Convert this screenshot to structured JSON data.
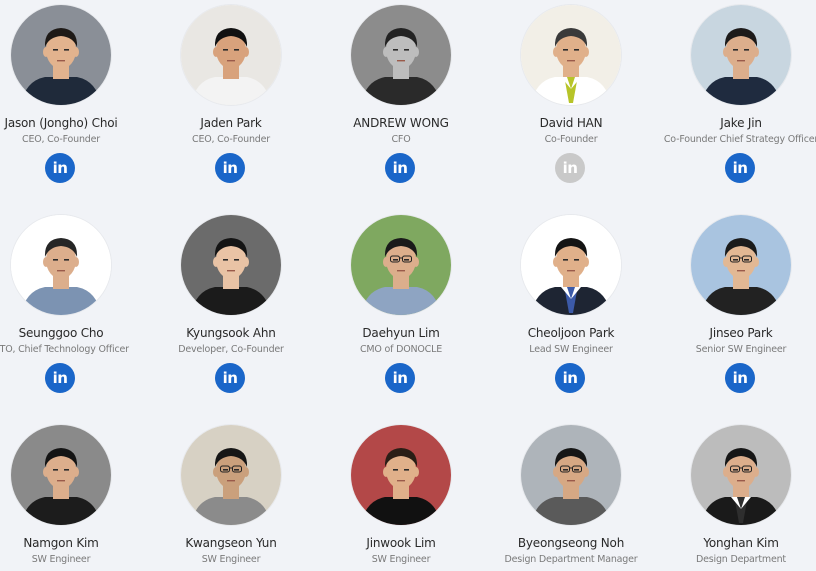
{
  "team": [
    {
      "name": "Jason (Jongho) Choi",
      "role": "CEO, Co-Founder",
      "linkedin": "in",
      "linkedin_active": true,
      "photo": {
        "bg": "#8a8f97",
        "skin": "#e2b38e",
        "hair": "#1e1a17",
        "shirt": "#1f2a3a",
        "glasses": false
      }
    },
    {
      "name": "Jaden Park",
      "role": "CEO, Co-Founder",
      "linkedin": "in",
      "linkedin_active": true,
      "photo": {
        "bg": "#e9e7e3",
        "skin": "#d8a27c",
        "hair": "#111111",
        "shirt": "#f3f3f3",
        "glasses": false
      }
    },
    {
      "name": "ANDREW WONG",
      "role": "CFO",
      "linkedin": "in",
      "linkedin_active": true,
      "photo": {
        "bg": "#8c8c8c",
        "skin": "#bdbdbd",
        "hair": "#222222",
        "shirt": "#2a2a2a",
        "glasses": false
      }
    },
    {
      "name": "David HAN",
      "role": "Co-Founder",
      "linkedin": "in",
      "linkedin_active": false,
      "photo": {
        "bg": "#f2efe7",
        "skin": "#e0b08a",
        "hair": "#3a3a3a",
        "shirt": "#ffffff",
        "glasses": false,
        "tie": "#b7c428"
      }
    },
    {
      "name": "Jake Jin",
      "role": "Co-Founder Chief Strategy Officer",
      "linkedin": "in",
      "linkedin_active": true,
      "photo": {
        "bg": "#c8d6e0",
        "skin": "#dcae8c",
        "hair": "#1d1b1a",
        "shirt": "#1f2b3f",
        "glasses": false
      }
    },
    {
      "name": "Seunggoo Cho",
      "role": "CTO, Chief Technology Officer",
      "linkedin": "in",
      "linkedin_active": true,
      "photo": {
        "bg": "#ffffff",
        "skin": "#dcae8c",
        "hair": "#262626",
        "shirt": "#7c93b2",
        "glasses": false
      }
    },
    {
      "name": "Kyungsook Ahn",
      "role": "Developer, Co-Founder",
      "linkedin": "in",
      "linkedin_active": true,
      "photo": {
        "bg": "#6b6b6b",
        "skin": "#e9c3a5",
        "hair": "#141414",
        "shirt": "#1b1b1b",
        "glasses": false
      }
    },
    {
      "name": "Daehyun Lim",
      "role": "CMO of DONOCLE",
      "linkedin": "in",
      "linkedin_active": true,
      "photo": {
        "bg": "#7fa860",
        "skin": "#dcae8c",
        "hair": "#1a1a1a",
        "shirt": "#8ea4c2",
        "glasses": true
      }
    },
    {
      "name": "Cheoljoon Park",
      "role": "Lead SW Engineer",
      "linkedin": "in",
      "linkedin_active": true,
      "photo": {
        "bg": "#ffffff",
        "skin": "#e0b08a",
        "hair": "#141414",
        "shirt": "#1e2533",
        "glasses": false,
        "tie": "#3c5aa8"
      }
    },
    {
      "name": "Jinseo Park",
      "role": "Senior SW Engineer",
      "linkedin": "in",
      "linkedin_active": true,
      "photo": {
        "bg": "#a9c4e0",
        "skin": "#e2b894",
        "hair": "#1b1b1b",
        "shirt": "#222222",
        "glasses": true
      }
    },
    {
      "name": "Namgon Kim",
      "role": "SW Engineer",
      "linkedin": "in",
      "linkedin_active": false,
      "photo": {
        "bg": "#8a8a8a",
        "skin": "#dcae8c",
        "hair": "#141414",
        "shirt": "#1c1c1c",
        "glasses": false
      }
    },
    {
      "name": "Kwangseon Yun",
      "role": "SW Engineer",
      "linkedin": "in",
      "linkedin_active": false,
      "photo": {
        "bg": "#d7d1c4",
        "skin": "#caa07c",
        "hair": "#161616",
        "shirt": "#8b8b8b",
        "glasses": true
      }
    },
    {
      "name": "Jinwook Lim",
      "role": "SW Engineer",
      "linkedin": "in",
      "linkedin_active": false,
      "photo": {
        "bg": "#b34848",
        "skin": "#e0b08a",
        "hair": "#2a1e16",
        "shirt": "#111111",
        "glasses": false
      }
    },
    {
      "name": "Byeongseong Noh",
      "role": "Design Department Manager",
      "linkedin": "in",
      "linkedin_active": false,
      "photo": {
        "bg": "#aeb4ba",
        "skin": "#d6a884",
        "hair": "#161616",
        "shirt": "#5a5a5a",
        "glasses": true
      }
    },
    {
      "name": "Yonghan Kim",
      "role": "Design Department",
      "linkedin": "in",
      "linkedin_active": false,
      "photo": {
        "bg": "#bcbcbc",
        "skin": "#dcae8c",
        "hair": "#161616",
        "shirt": "#1a1a1a",
        "glasses": true,
        "tie": "#2e2e2e"
      }
    }
  ]
}
